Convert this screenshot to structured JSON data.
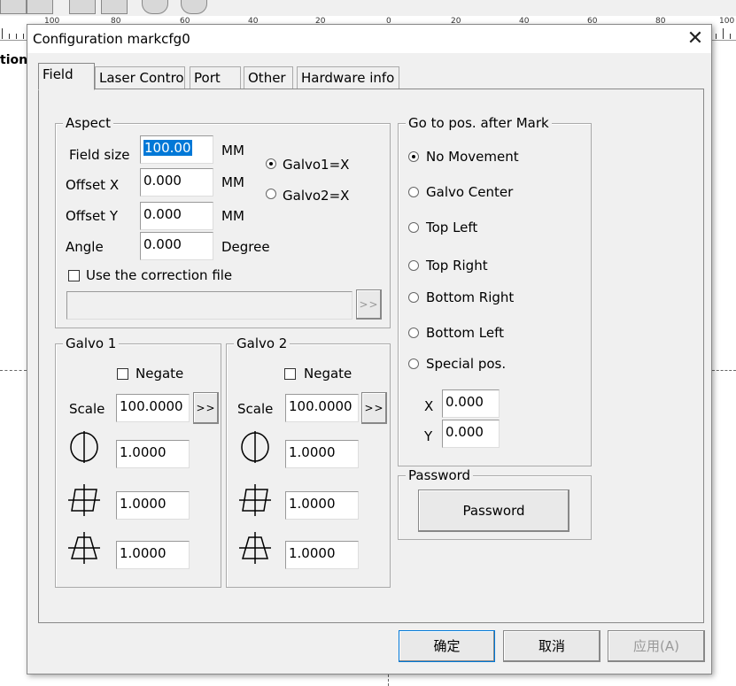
{
  "background": {
    "ruler_ticks": [
      "100",
      "80",
      "60",
      "40",
      "20",
      "0",
      "20",
      "40",
      "60",
      "80",
      "100"
    ],
    "side_label": "tion"
  },
  "dialog": {
    "title": "Configuration markcfg0",
    "close_glyph": "✕",
    "tabs": [
      {
        "label": "Field",
        "active": true
      },
      {
        "label": "Laser Contro",
        "active": false
      },
      {
        "label": "Port",
        "active": false
      },
      {
        "label": "Other",
        "active": false
      },
      {
        "label": "Hardware info",
        "active": false
      }
    ],
    "aspect": {
      "title": "Aspect",
      "field_size_label": "Field size",
      "field_size_value": "100.00",
      "field_size_unit": "MM",
      "offset_x_label": "Offset X",
      "offset_x_value": "0.000",
      "offset_x_unit": "MM",
      "offset_y_label": "Offset Y",
      "offset_y_value": "0.000",
      "offset_y_unit": "MM",
      "angle_label": "Angle",
      "angle_value": "0.000",
      "angle_unit": "Degree",
      "galvo1_radio": "Galvo1=X",
      "galvo2_radio": "Galvo2=X",
      "selected_galvo": "Galvo1=X",
      "use_correction_label": "Use the correction file",
      "use_correction_checked": false,
      "correction_path": "",
      "browse_label": ">>"
    },
    "galvo1": {
      "title": "Galvo 1",
      "negate_label": "Negate",
      "negate_checked": false,
      "scale_label": "Scale",
      "scale_value": "100.0000",
      "scale_button": ">>",
      "param1": "1.0000",
      "param2": "1.0000",
      "param3": "1.0000"
    },
    "galvo2": {
      "title": "Galvo 2",
      "negate_label": "Negate",
      "negate_checked": false,
      "scale_label": "Scale",
      "scale_value": "100.0000",
      "scale_button": ">>",
      "param1": "1.0000",
      "param2": "1.0000",
      "param3": "1.0000"
    },
    "goto_pos": {
      "title": "Go to pos. after Mark",
      "options": [
        "No Movement",
        "Galvo Center",
        "Top Left",
        "Top Right",
        "Bottom Right",
        "Bottom Left",
        "Special pos."
      ],
      "selected": "No Movement",
      "x_label": "X",
      "x_value": "0.000",
      "y_label": "Y",
      "y_value": "0.000"
    },
    "password": {
      "title": "Password",
      "button_label": "Password"
    },
    "footer": {
      "ok_label": "确定",
      "cancel_label": "取消",
      "apply_label": "应用(A)",
      "apply_enabled": false
    }
  }
}
